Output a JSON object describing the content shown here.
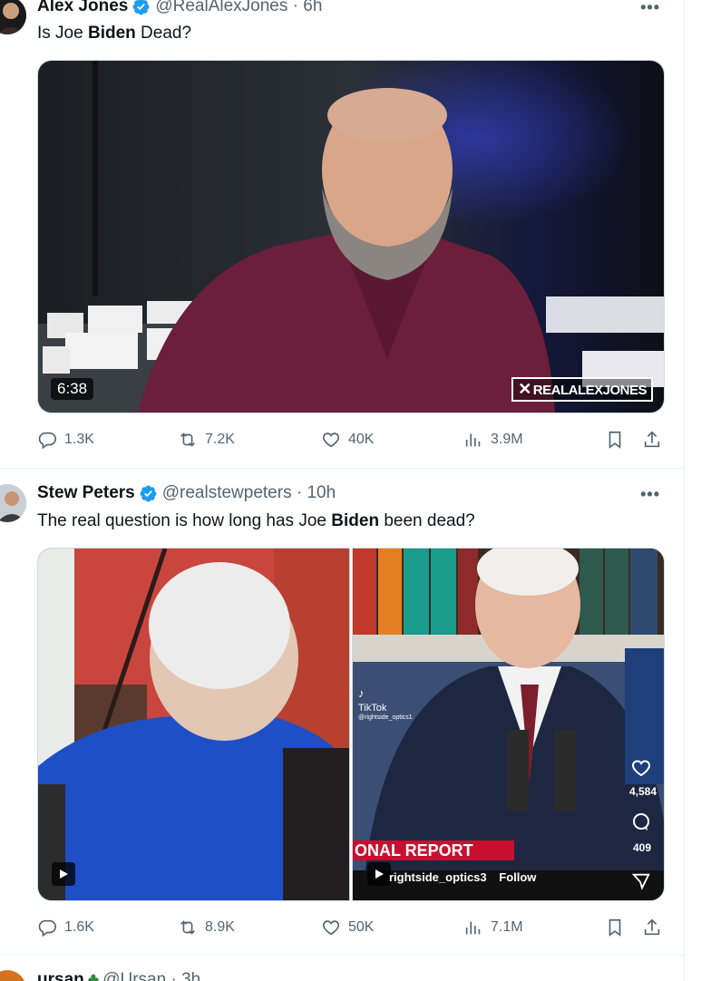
{
  "tweets": [
    {
      "name": "Alex Jones",
      "handle": "@RealAlexJones",
      "time": "· 6h",
      "text_pre": "Is Joe ",
      "text_bold": "Biden",
      "text_post": " Dead?",
      "media": {
        "duration": "6:38",
        "watermark": "REALALEXJONES"
      },
      "stats": {
        "replies": "1.3K",
        "reposts": "7.2K",
        "likes": "40K",
        "views": "3.9M"
      }
    },
    {
      "name": "Stew Peters",
      "handle": "@realstewpeters",
      "time": "· 10h",
      "text_pre": "The real question is how long has Joe ",
      "text_bold": "Biden",
      "text_post": " been dead?",
      "media": {
        "tiktok_label": "TikTok",
        "tiktok_user": "@rightside_optics1",
        "news_banner": "ONAL REPORT",
        "follow_user": "rightside_optics3",
        "follow_label": "Follow",
        "likes_count": "4,584",
        "comments_count": "409"
      },
      "stats": {
        "replies": "1.6K",
        "reposts": "8.9K",
        "likes": "50K",
        "views": "7.1M"
      }
    },
    {
      "name": "ursan",
      "handle": "@Ursan",
      "time": "· 3h"
    }
  ],
  "more_label": "•••",
  "colors": {
    "verified": "#1d9bf0",
    "secondary": "#536471",
    "divider": "#eff3f4"
  }
}
